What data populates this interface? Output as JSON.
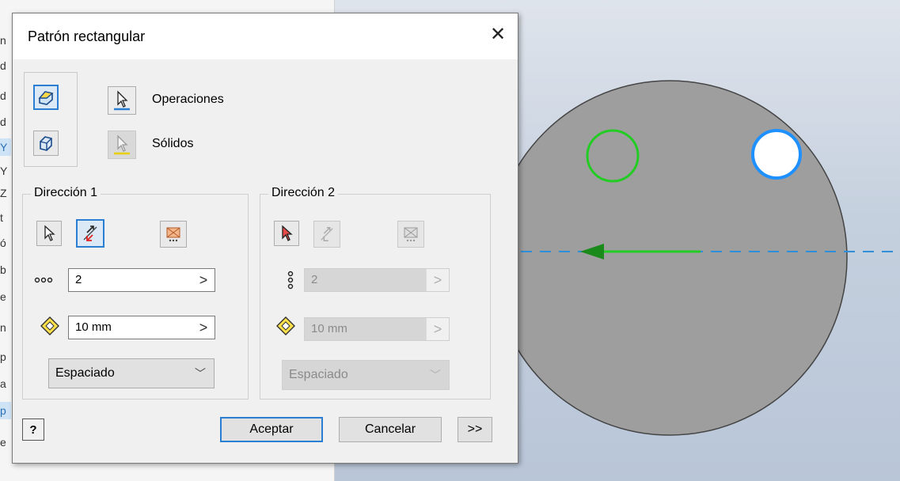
{
  "left_panel": {
    "strip_chars": [
      "n",
      "d",
      "d",
      "d",
      "Y",
      "Y",
      "Z",
      "t",
      "ó",
      "b",
      "e",
      "n",
      "p",
      "a",
      "p",
      "e"
    ]
  },
  "dialog": {
    "title": "Patrón rectangular",
    "close_glyph": "✕",
    "selectors": {
      "operations_label": "Operaciones",
      "solids_label": "Sólidos"
    },
    "direction1": {
      "title": "Dirección 1",
      "count_value": "2",
      "distance_value": "10 mm",
      "spacing_option": "Espaciado",
      "arrow_glyph": ">"
    },
    "direction2": {
      "title": "Dirección 2",
      "count_value": "2",
      "distance_value": "10 mm",
      "spacing_option": "Espaciado",
      "arrow_glyph": ">"
    },
    "buttons": {
      "help": "?",
      "ok": "Aceptar",
      "cancel": "Cancelar",
      "more": ">>"
    }
  },
  "colors": {
    "accent_blue": "#2b7fd3",
    "part_fill": "#9e9e9e",
    "feature_green": "#22cc22",
    "hole_blue": "#1e90ff",
    "axis_dash": "#2f8fd8"
  }
}
